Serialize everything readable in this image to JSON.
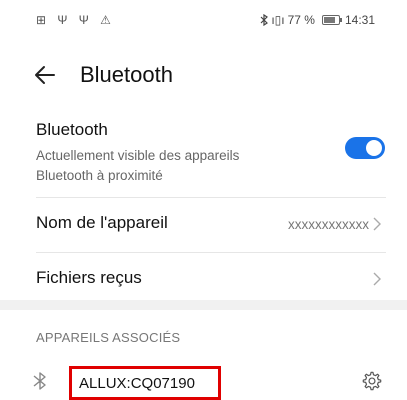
{
  "status_bar": {
    "left_icons": "⊞ Ψ Ψ ⚠",
    "bluetooth_icon": "bluetooth-icon",
    "signal_text": "ı▯ı",
    "battery_percent": "77 %",
    "time": "14:31"
  },
  "header": {
    "title": "Bluetooth"
  },
  "bluetooth_row": {
    "label": "Bluetooth",
    "description": "Actuellement visible des appareils Bluetooth à proximité",
    "enabled": true,
    "toggle_color": "#1a73e8"
  },
  "device_name_row": {
    "label": "Nom de l'appareil",
    "value": "xxxxxxxxxxxx"
  },
  "received_files_row": {
    "label": "Fichiers reçus"
  },
  "paired_section": {
    "title": "APPAREILS ASSOCIÉS",
    "devices": [
      {
        "name": "ALLUX:CQ07190",
        "highlight_color": "#e00000"
      }
    ]
  }
}
